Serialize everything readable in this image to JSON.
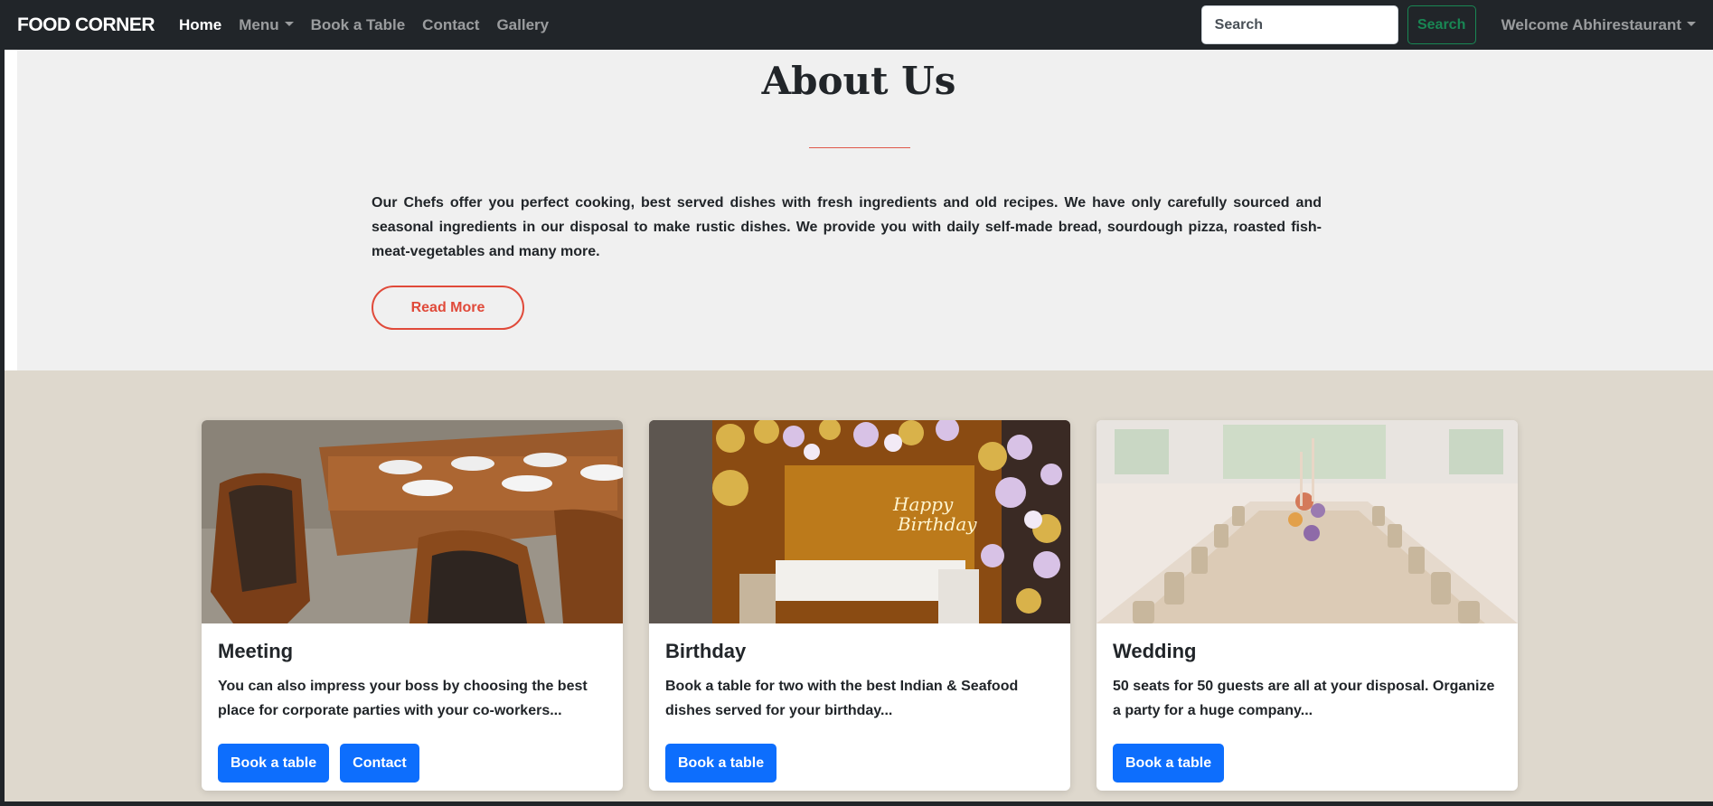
{
  "navbar": {
    "brand": "FOOD CORNER",
    "links": [
      {
        "label": "Home"
      },
      {
        "label": "Menu"
      },
      {
        "label": "Book a Table"
      },
      {
        "label": "Contact"
      },
      {
        "label": "Gallery"
      }
    ],
    "search": {
      "placeholder": "Search",
      "button_label": "Search"
    },
    "user_menu": "Welcome Abhirestaurant"
  },
  "about": {
    "title": "About Us",
    "text": "Our Chefs offer you perfect cooking, best served dishes with fresh ingredients and old recipes. We have only carefully sourced and seasonal ingredients in our disposal to make rustic dishes. We provide you with daily self-made bread, sourdough pizza, roasted fish-meat-vegetables and many more.",
    "read_more": "Read More"
  },
  "cards": [
    {
      "title": "Meeting",
      "text": "You can also impress your boss by choosing the best place for corporate parties with your co-workers...",
      "buttons": [
        "Book a table",
        "Contact"
      ]
    },
    {
      "title": "Birthday",
      "text": "Book a table for two with the best Indian & Seafood dishes served for your birthday...",
      "buttons": [
        "Book a table"
      ]
    },
    {
      "title": "Wedding",
      "text": "50 seats for 50 guests are all at your disposal. Organize a party for a huge company...",
      "buttons": [
        "Book a table"
      ]
    }
  ],
  "colors": {
    "navbar_bg": "#212529",
    "accent_red": "#e04a3a",
    "primary_blue": "#0d6efd",
    "success_green": "#198754",
    "events_bg": "#ded8cd"
  }
}
